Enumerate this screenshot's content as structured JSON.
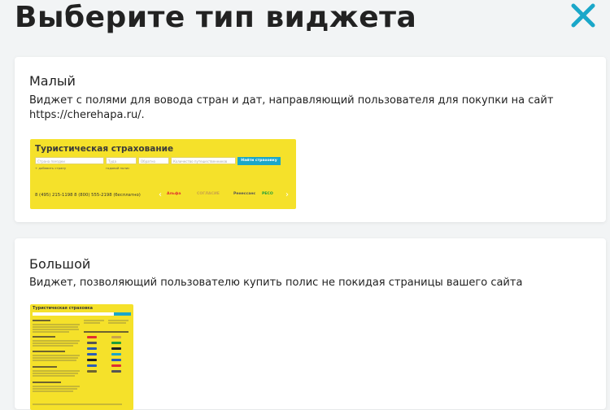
{
  "modal": {
    "title": "Выберите тип виджета"
  },
  "colors": {
    "accent": "#1aa7c9",
    "widget_yellow": "#f5e12a"
  },
  "icons": {
    "close": "close-icon"
  },
  "cards": [
    {
      "title": "Малый",
      "description": "Виджет с полями для вовода стран и дат, направляющий пользователя для покупки на сайт https://cherehapa.ru/."
    },
    {
      "title": "Большой",
      "description": "Виджет, позволяющий пользователю купить полис не покидая страницы вашего сайта"
    }
  ],
  "small_preview": {
    "title": "Туристическая страхование",
    "country_placeholder": "Страна поездки",
    "there": "Туда",
    "back": "Обратно",
    "travelers": "Количество путешественников",
    "button": "Найти страховку",
    "add_country": "+ добавить страну",
    "annual": "годовой полис",
    "phones": "8 (495) 215-1198   8 (800) 555-2198 (бесплатно)",
    "logos": [
      "Альфа",
      "СОГЛАСИЕ",
      "Ренессанс",
      "РЕСО"
    ]
  },
  "large_preview": {
    "title": "Туристическая страховка"
  }
}
